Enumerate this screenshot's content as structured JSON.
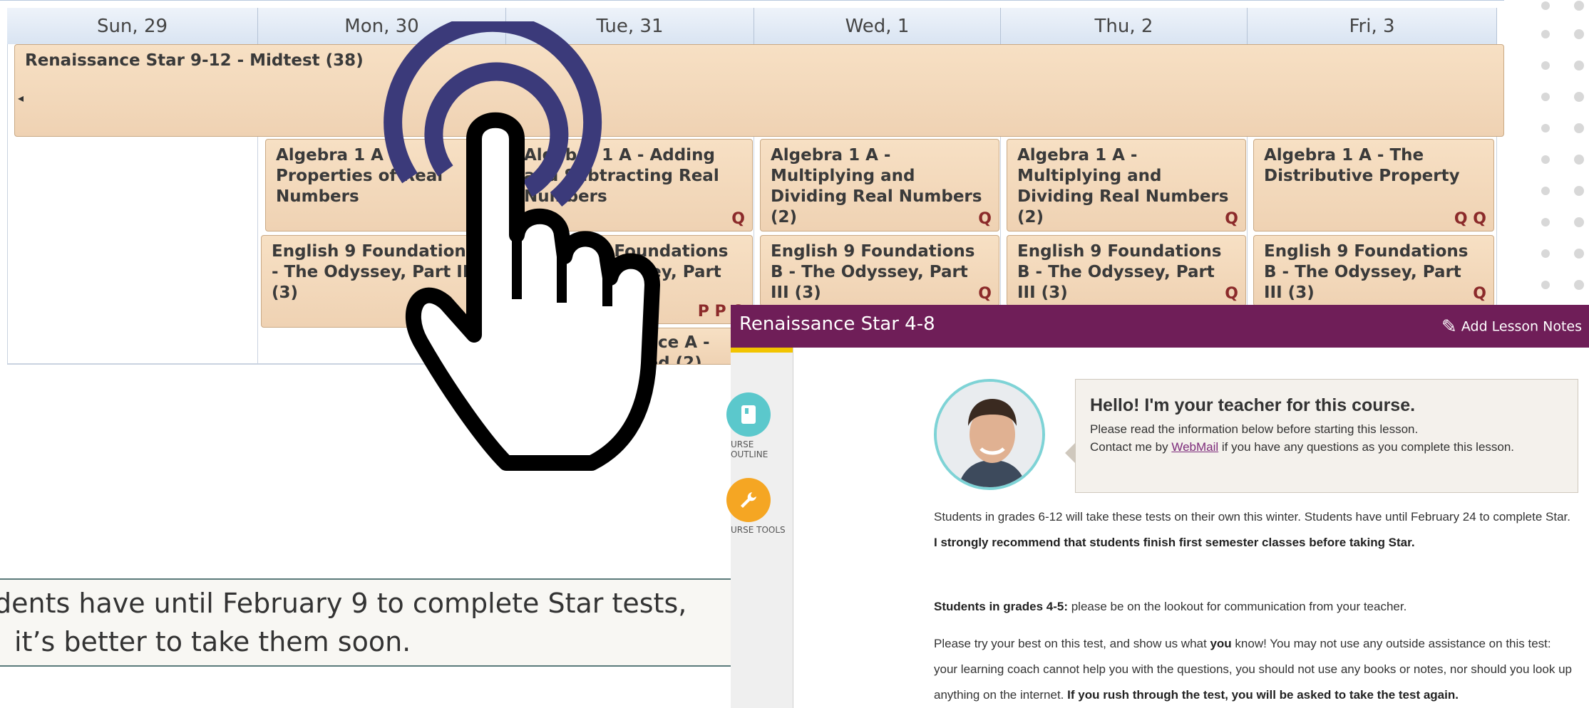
{
  "calendar": {
    "days": [
      "Sun, 29",
      "Mon, 30",
      "Tue, 31",
      "Wed, 1",
      "Thu, 2",
      "Fri, 3"
    ],
    "all_day_event": "Renaissance Star 9-12 - Midtest (38)",
    "row1": [
      {
        "title": "Algebra 1 A - Properties of Real Numbers",
        "icons": "P D"
      },
      {
        "title": "Algebra 1 A - Adding and Subtracting Real Numbers",
        "icons": "Q"
      },
      {
        "title": "Algebra 1 A - Multiplying and Dividing Real Numbers (2)",
        "icons": "Q"
      },
      {
        "title": "Algebra 1 A - Multiplying and Dividing Real Numbers (2)",
        "icons": "Q"
      },
      {
        "title": "Algebra 1 A - The Distributive Property",
        "icons": "Q Q"
      }
    ],
    "row2": [
      {
        "title": "English 9 Foundations B - The Odyssey, Part III (3)",
        "icons": ""
      },
      {
        "title": "English 9 Foundations B - The Odyssey, Part III (3)",
        "icons": "P P Q"
      },
      {
        "title": "English 9 Foundations B - The Odyssey, Part III (3)",
        "icons": "Q"
      },
      {
        "title": "English 9 Foundations B - The Odyssey, Part III (3)",
        "icons": "Q"
      },
      {
        "title": "English 9 Foundations B - The Odyssey, Part III (3)",
        "icons": "Q"
      }
    ],
    "row3_partial": "ence A - hod (2)"
  },
  "caption": {
    "line1": "dents have until February 9 to complete Star tests,",
    "line2": "it’s better to take them soon."
  },
  "course": {
    "title": "Renaissance Star 4-8",
    "notes_button": "Add Lesson Notes",
    "sidebar": [
      {
        "label": "URSE OUTLINE",
        "icon": "book-icon",
        "color": "#5bc8cc"
      },
      {
        "label": "URSE TOOLS",
        "icon": "wrench-icon",
        "color": "#f5a623"
      }
    ],
    "teacher_heading": "Hello! I'm your teacher for this course.",
    "teacher_line1": "Please read the information below before starting this lesson.",
    "teacher_line2_pre": "Contact me by",
    "teacher_link": "WebMail",
    "teacher_line2_post": "if you have any questions as you complete this lesson.",
    "para1_normal": "Students in grades 6-12 will take these tests on their own this winter. Students have until February 24 to complete Star.",
    "para1_bold": "I strongly recommend that students finish first semester classes before taking Star.",
    "para2_bold": "Students in grades 4-5:",
    "para2_normal": "please be on the lookout for communication from your teacher.",
    "para3_a": "Please try your best on this test, and show us what",
    "para3_you": "you",
    "para3_b": "know! You may not use any outside assistance on this test: your learning coach cannot help you with the questions, you should not use any books or notes, nor should you look up anything on the internet.",
    "para3_bold": "If you rush through the test, you will be asked to take the test again."
  },
  "colors": {
    "course_bar": "#6f1e58",
    "event_fill": "#f2d9bd",
    "hand_rings": "#3b3a7a",
    "accent_yellow": "#f2c400"
  }
}
